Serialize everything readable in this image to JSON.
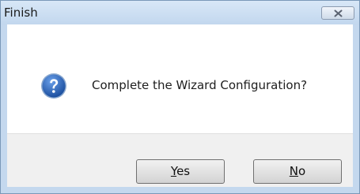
{
  "window": {
    "title": "Finish"
  },
  "message": {
    "text": "Complete the Wizard Configuration?",
    "icon": "question-icon"
  },
  "buttons": {
    "yes": {
      "mnemonic": "Y",
      "rest": "es"
    },
    "no": {
      "mnemonic": "N",
      "rest": "o"
    }
  },
  "colors": {
    "titlebar": "#c4d8ee",
    "button_area": "#f0f0f0",
    "icon": "#2a5fb8"
  }
}
